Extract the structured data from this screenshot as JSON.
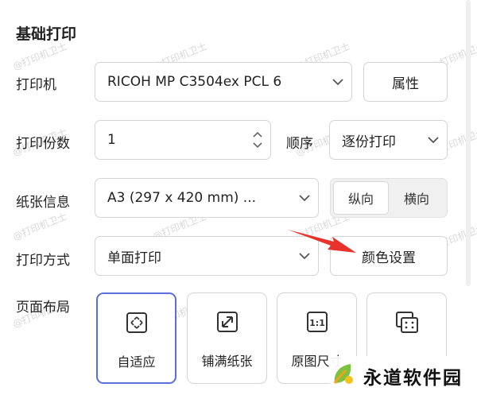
{
  "section_title": "基础打印",
  "printer": {
    "label": "打印机",
    "value": "RICOH MP C3504ex PCL 6",
    "properties_button": "属性"
  },
  "copies": {
    "label": "打印份数",
    "value": "1",
    "order_label": "顺序",
    "order_value": "逐份打印"
  },
  "paper": {
    "label": "纸张信息",
    "value": "A3 (297 x 420 mm) ...",
    "orientation_options": [
      "纵向",
      "横向"
    ],
    "orientation_selected": "纵向"
  },
  "print_mode": {
    "label": "打印方式",
    "value": "单面打印",
    "color_settings_button": "颜色设置"
  },
  "layout": {
    "label": "页面布局",
    "options": [
      {
        "label": "自适应",
        "icon": "fit-icon",
        "selected": true
      },
      {
        "label": "铺满纸张",
        "icon": "expand-icon",
        "selected": false
      },
      {
        "label": "原图尺寸",
        "icon": "original-size-icon",
        "selected": false
      },
      {
        "label": "",
        "icon": "multi-page-icon",
        "selected": false
      }
    ]
  },
  "watermark_text": "@打印机卫士",
  "corner_badge": "永道软件园",
  "colors": {
    "accent_selected_border": "#5b6fdc",
    "annotation_arrow": "#e8322b",
    "border": "#d4d4d4"
  }
}
